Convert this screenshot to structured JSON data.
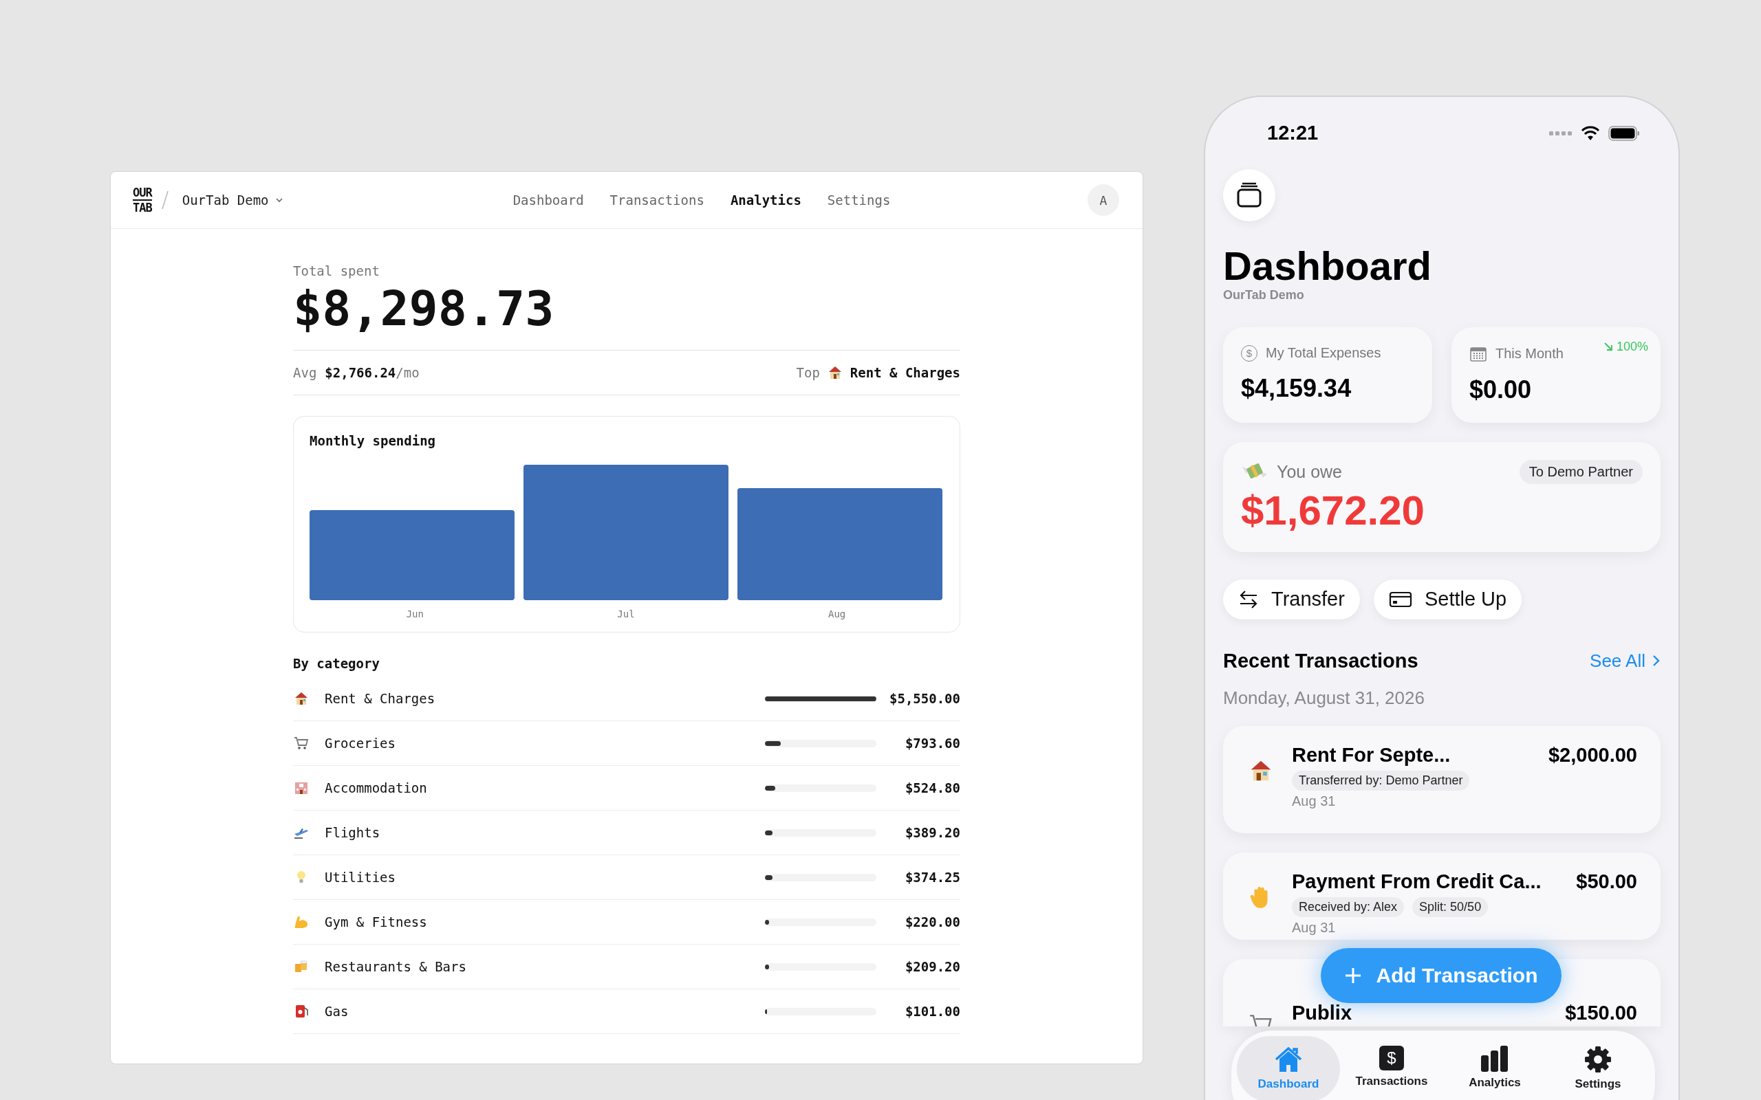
{
  "web": {
    "logo": [
      "OUR",
      "TAB"
    ],
    "workspace": "OurTab Demo",
    "nav": [
      {
        "label": "Dashboard",
        "selected": false
      },
      {
        "label": "Transactions",
        "selected": false
      },
      {
        "label": "Analytics",
        "selected": true
      },
      {
        "label": "Settings",
        "selected": false
      }
    ],
    "avatar": "A",
    "total_label": "Total spent",
    "total": "$8,298.73",
    "avg_label": "Avg",
    "avg_value": "$2,766.24",
    "avg_unit": "/mo",
    "top_label": "Top",
    "top_value": "Rent & Charges",
    "chart": {
      "title": "Monthly spending",
      "categories": [
        "Jun",
        "Jul",
        "Aug"
      ]
    },
    "category_title": "By category",
    "categories": [
      {
        "name": "Rent & Charges",
        "amount": "$5,550.00",
        "level": 1
      },
      {
        "name": "Groceries",
        "amount": "$793.60",
        "level": 0.143
      },
      {
        "name": "Accommodation",
        "amount": "$524.80",
        "level": 0.095
      },
      {
        "name": "Flights",
        "amount": "$389.20",
        "level": 0.07
      },
      {
        "name": "Utilities",
        "amount": "$374.25",
        "level": 0.067
      },
      {
        "name": "Gym & Fitness",
        "amount": "$220.00",
        "level": 0.04
      },
      {
        "name": "Restaurants & Bars",
        "amount": "$209.20",
        "level": 0.038
      },
      {
        "name": "Gas",
        "amount": "$101.00",
        "level": 0.018
      }
    ]
  },
  "phone": {
    "time": "12:21",
    "title": "Dashboard",
    "subtitle": "OurTab Demo",
    "stats": [
      {
        "label": "My Total Expenses",
        "value": "$4,159.34",
        "icon": "$"
      },
      {
        "label": "This Month",
        "value": "$0.00",
        "trend": "100%"
      }
    ],
    "owe": {
      "label": "You owe",
      "to": "To Demo Partner",
      "amount": "$1,672.20"
    },
    "actions": [
      "Transfer",
      "Settle Up"
    ],
    "recent_title": "Recent Transactions",
    "see_all": "See All",
    "date": "Monday, August 31, 2026",
    "transactions": [
      {
        "title": "Rent For Septe...",
        "amount": "$2,000.00",
        "tags": [
          "Transferred by: Demo Partner"
        ],
        "date": "Aug 31"
      },
      {
        "title": "Payment From Credit Ca...",
        "amount": "$50.00",
        "tags": [
          "Received by: Alex",
          "Split: 50/50"
        ],
        "date": "Aug 31"
      },
      {
        "title": "Publix",
        "amount": "$150.00"
      }
    ],
    "fab": "Add Transaction",
    "tabs": [
      {
        "label": "Dashboard",
        "selected": true
      },
      {
        "label": "Transactions",
        "selected": false,
        "icon": "$"
      },
      {
        "label": "Analytics",
        "selected": false
      },
      {
        "label": "Settings",
        "selected": false
      }
    ]
  }
}
